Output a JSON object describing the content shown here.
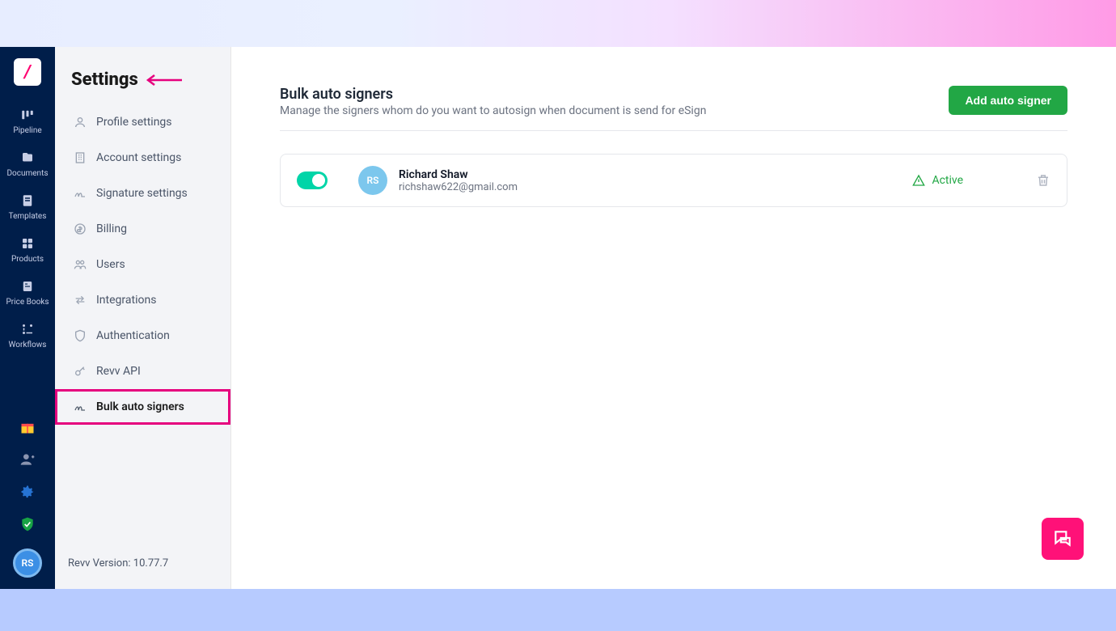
{
  "rail": {
    "items": [
      {
        "label": "Pipeline"
      },
      {
        "label": "Documents"
      },
      {
        "label": "Templates"
      },
      {
        "label": "Products"
      },
      {
        "label": "Price Books"
      },
      {
        "label": "Workflows"
      }
    ],
    "avatar_initials": "RS"
  },
  "settings": {
    "title": "Settings",
    "items": [
      {
        "label": "Profile settings"
      },
      {
        "label": "Account settings"
      },
      {
        "label": "Signature settings"
      },
      {
        "label": "Billing"
      },
      {
        "label": "Users"
      },
      {
        "label": "Integrations"
      },
      {
        "label": "Authentication"
      },
      {
        "label": "Revv API"
      },
      {
        "label": "Bulk auto signers"
      }
    ],
    "version": "Revv Version: 10.77.7"
  },
  "main": {
    "title": "Bulk auto signers",
    "subtitle": "Manage the signers whom do you want to autosign when document is send for eSign",
    "add_button": "Add auto signer",
    "signer": {
      "initials": "RS",
      "name": "Richard Shaw",
      "email": "richshaw622@gmail.com",
      "status": "Active"
    }
  }
}
